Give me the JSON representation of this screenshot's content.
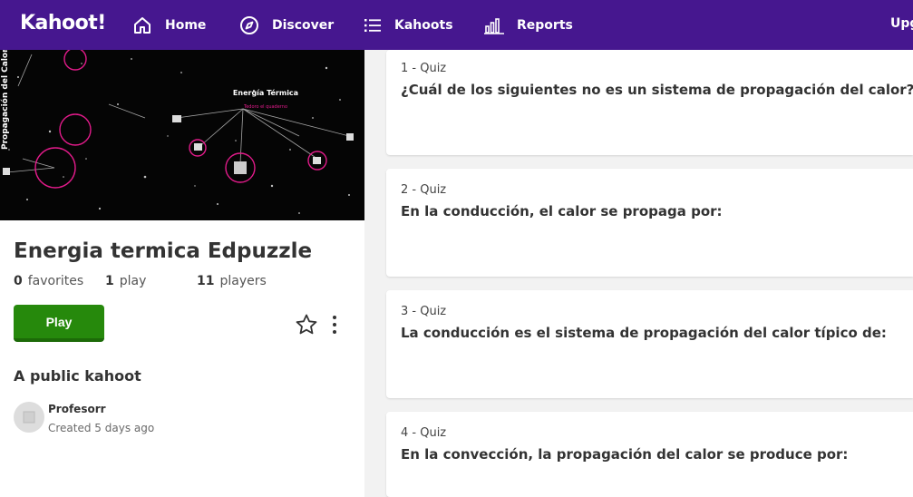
{
  "nav": {
    "logo": "Kahoot!",
    "home": "Home",
    "discover": "Discover",
    "kahoots": "Kahoots",
    "reports": "Reports",
    "upgrade": "Upg"
  },
  "cover": {
    "title": "Energía Térmica",
    "subtitle": "Tedoro el quaderno",
    "side_text": "Propagación del Calor"
  },
  "kahoot": {
    "title": "Energia termica Edpuzzle",
    "favorites_count": "0",
    "favorites_label": "favorites",
    "plays_count": "1",
    "plays_label": "play",
    "players_count": "11",
    "players_label": "players",
    "play_button": "Play",
    "visibility": "A public kahoot",
    "author": "Profesorr",
    "created": "Created 5 days ago"
  },
  "questions": [
    {
      "number": "1 - Quiz",
      "text": "¿Cuál de los siguientes no es un sistema de propagación del calor?"
    },
    {
      "number": "2 - Quiz",
      "text": "En la conducción, el calor se propaga por:"
    },
    {
      "number": "3 - Quiz",
      "text": "La conducción es el sistema de propagación del calor típico de:"
    },
    {
      "number": "4 - Quiz",
      "text": "En la convección, la propagación del calor se produce por:"
    }
  ],
  "colors": {
    "nav_bg": "#46178f",
    "play_green": "#26890c",
    "accent_pink": "#e21b8a"
  },
  "icons": {
    "home": "home-icon",
    "discover": "compass-icon",
    "kahoots": "list-icon",
    "reports": "bar-chart-icon",
    "favorite": "star-icon",
    "more": "more-vertical-icon"
  }
}
